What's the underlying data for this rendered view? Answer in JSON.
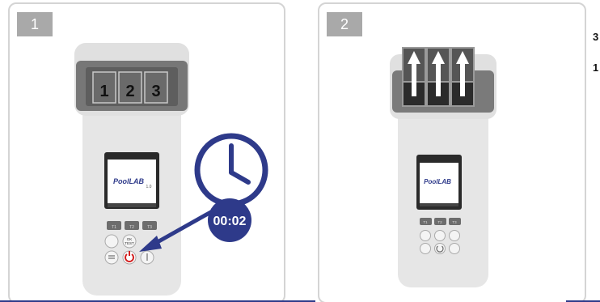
{
  "panels": [
    {
      "step": "1",
      "cells": [
        "1",
        "2",
        "3"
      ],
      "screen_logo": "PoolLAB",
      "screen_logo_suffix": "1.0",
      "keys": [
        "T1",
        "T2",
        "T3"
      ],
      "ok_label": "OK\nTEST",
      "timer": "00:02"
    },
    {
      "step": "2",
      "screen_logo": "PoolLAB",
      "keys": [
        "T1",
        "T2",
        "T3"
      ]
    }
  ],
  "side_text": [
    "3",
    "1"
  ],
  "colors": {
    "accent": "#2e3a8a",
    "device_body": "#e6e6e6",
    "device_dark": "#7a7a7a",
    "power": "#d22020"
  }
}
